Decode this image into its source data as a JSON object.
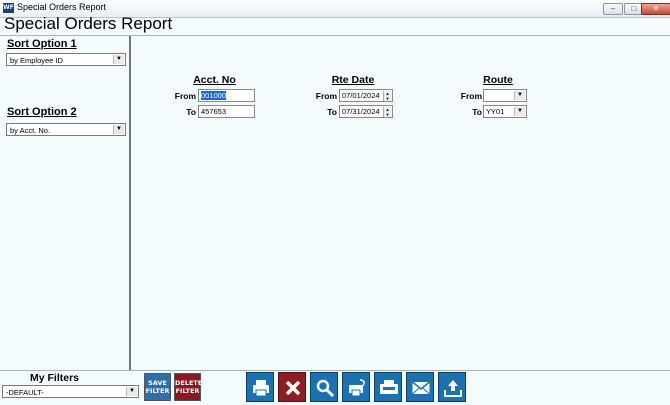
{
  "window": {
    "title": "Special Orders Report",
    "icon_text": "WF"
  },
  "report": {
    "title": "Special Orders Report"
  },
  "sort_option_1": {
    "label": "Sort Option 1",
    "value": "by Employee ID"
  },
  "sort_option_2": {
    "label": "Sort Option 2",
    "value": "by Acct. No."
  },
  "filters": {
    "acct_no": {
      "header": "Acct. No",
      "from_label": "From",
      "from_value": "001000",
      "to_label": "To",
      "to_value": "457653"
    },
    "rte_date": {
      "header": "Rte Date",
      "from_label": "From",
      "from_value": "07/01/2024",
      "to_label": "To",
      "to_value": "07/31/2024"
    },
    "route": {
      "header": "Route",
      "from_label": "From",
      "from_value": "",
      "to_label": "To",
      "to_value": "YY01"
    }
  },
  "my_filters": {
    "label": "My Filters",
    "value": "-DEFAULT-"
  },
  "buttons": {
    "save_filter": {
      "line1": "SAVE",
      "line2": "FILTER"
    },
    "delete_filter": {
      "line1": "DELETE",
      "line2": "FILTER"
    }
  },
  "toolbar_icons": [
    "print-icon",
    "cancel-icon",
    "preview-search-icon",
    "print-setup-icon",
    "fax-icon",
    "email-icon",
    "export-icon"
  ],
  "colors": {
    "accent_blue": "#1c72b0",
    "accent_red": "#8f1d24",
    "background": "#f3fbfc"
  }
}
